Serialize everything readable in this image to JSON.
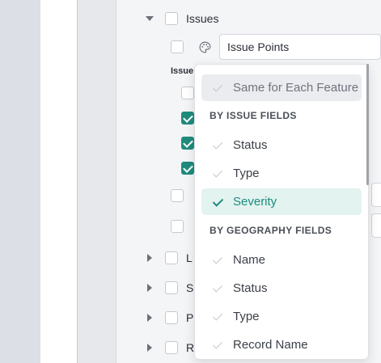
{
  "tree": {
    "issues_label": "Issues",
    "issues_sub_label": "Issue",
    "style_select_value": "Issue Points",
    "truncated_layers": [
      "L",
      "S",
      "P",
      "R"
    ]
  },
  "dropdown": {
    "same_for_each": "Same for Each Feature",
    "issue_fields_header": "BY ISSUE FIELDS",
    "issue_fields": [
      "Status",
      "Type",
      "Severity"
    ],
    "selected": "Severity",
    "geography_fields_header": "BY GEOGRAPHY FIELDS",
    "geography_fields": [
      "Name",
      "Status",
      "Type",
      "Record Name"
    ]
  },
  "colors": {
    "accent": "#1f8b7d",
    "selected_bg": "#e2f3f0",
    "disabled_bg": "#ebecf0"
  }
}
